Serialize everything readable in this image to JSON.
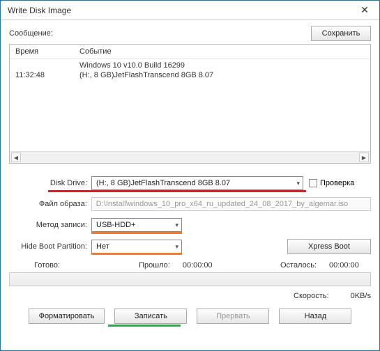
{
  "titlebar": {
    "title": "Write Disk Image",
    "close": "✕"
  },
  "message": {
    "label": "Сообщение:",
    "save_btn": "Сохранить"
  },
  "log": {
    "head_time": "Время",
    "head_event": "Событие",
    "rows": [
      {
        "time": "",
        "event": "Windows 10 v10.0 Build 16299"
      },
      {
        "time": "11:32:48",
        "event": "(H:, 8 GB)JetFlashTranscend 8GB    8.07"
      }
    ]
  },
  "form": {
    "disk_drive_label": "Disk Drive:",
    "disk_drive_value": "(H:, 8 GB)JetFlashTranscend 8GB    8.07",
    "check_label": "Проверка",
    "image_file_label": "Файл образа:",
    "image_file_value": "D:\\Install\\windows_10_pro_x64_ru_updated_24_08_2017_by_algemar.iso",
    "write_method_label": "Метод записи:",
    "write_method_value": "USB-HDD+",
    "hide_boot_label": "Hide Boot Partition:",
    "hide_boot_value": "Нет",
    "xpress_boot_btn": "Xpress Boot"
  },
  "progress": {
    "ready_label": "Готово:",
    "elapsed_label": "Прошло:",
    "elapsed_value": "00:00:00",
    "remain_label": "Осталось:",
    "remain_value": "00:00:00",
    "speed_label": "Скорость:",
    "speed_value": "0KB/s"
  },
  "buttons": {
    "format": "Форматировать",
    "write": "Записать",
    "abort": "Прервать",
    "back": "Назад"
  }
}
